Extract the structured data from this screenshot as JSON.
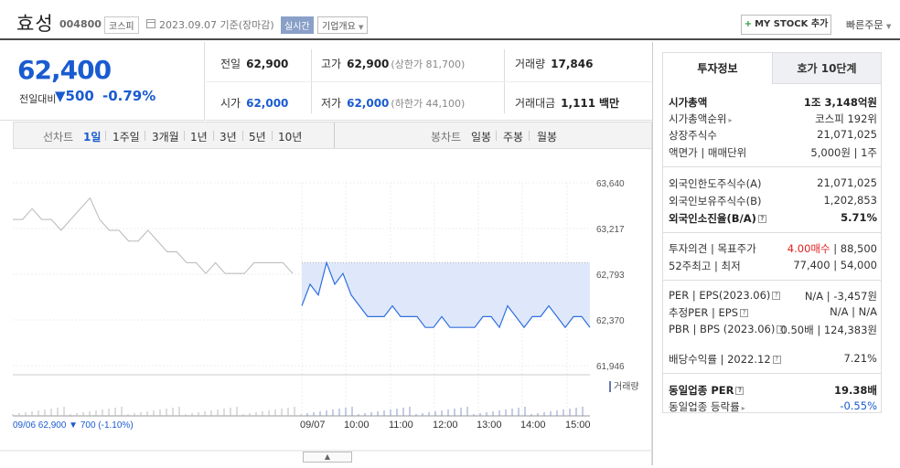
{
  "header": {
    "name": "효성",
    "code": "004800",
    "market_badge": "코스피",
    "date_text": "2023.09.07 기준(장마감)",
    "realtime_label": "실시간",
    "company_overview": "기업개요",
    "mystock_label": "MY STOCK 추가",
    "quick_order": "빠른주문"
  },
  "price": {
    "current": "62,400",
    "prev_label": "전일대비",
    "change": "500",
    "change_pct": "-0.79%"
  },
  "quote": {
    "prev_close_label": "전일",
    "prev_close": "62,900",
    "high_label": "고가",
    "high": "62,900",
    "high_sub": "(상한가 81,700)",
    "volume_label": "거래량",
    "volume": "17,846",
    "open_label": "시가",
    "open": "62,000",
    "low_label": "저가",
    "low": "62,000",
    "low_sub": "(하한가 44,100)",
    "amount_label": "거래대금",
    "amount": "1,111",
    "amount_unit": "백만"
  },
  "period_bar": {
    "line_label": "선차트",
    "line_items": [
      "1일",
      "1주일",
      "3개월",
      "1년",
      "3년",
      "5년",
      "10년"
    ],
    "active_index": 0,
    "candle_label": "봉차트",
    "candle_items": [
      "일봉",
      "주봉",
      "월봉"
    ]
  },
  "chart_data": {
    "type": "line",
    "y_ticks": [
      "63,640",
      "63,217",
      "62,793",
      "62,370",
      "61,946"
    ],
    "ylim": [
      61946,
      63640
    ],
    "x_ticks": [
      "09/07",
      "10:00",
      "11:00",
      "12:00",
      "13:00",
      "14:00",
      "15:00"
    ],
    "reference_line": 62900,
    "volume_label": "거래량",
    "prev_day_summary": "09/06  62,900 ▼ 700 (-1.10%)",
    "series": [
      {
        "values": [
          62500,
          62700,
          62600,
          62900,
          62700,
          62800,
          62600,
          62500,
          62400,
          62400,
          62400,
          62500,
          62400,
          62400,
          62400,
          62300,
          62300,
          62400,
          62300,
          62300,
          62300,
          62300,
          62400,
          62400,
          62300,
          62500,
          62400,
          62300,
          62400,
          62400,
          62500,
          62400,
          62300,
          62400,
          62400,
          62300
        ]
      }
    ],
    "prev_series_values": [
      63300,
      63300,
      63400,
      63300,
      63300,
      63200,
      63300,
      63400,
      63500,
      63300,
      63200,
      63200,
      63100,
      63100,
      63200,
      63100,
      63000,
      63000,
      62900,
      62900,
      62800,
      62900,
      62800,
      62800,
      62800,
      62900,
      62900,
      62900,
      62900,
      62800
    ]
  },
  "side": {
    "tab_info": "투자정보",
    "tab_quotes": "호가 10단계",
    "rows1": [
      {
        "k": "시가총액",
        "v": "1조 3,148억원"
      },
      {
        "k": "시가총액순위",
        "v": "코스피 192위"
      },
      {
        "k": "상장주식수",
        "v": "21,071,025"
      },
      {
        "k": "액면가 | 매매단위",
        "v": "5,000원 | 1주"
      }
    ],
    "rows2": [
      {
        "k": "외국인한도주식수(A)",
        "v": "21,071,025"
      },
      {
        "k": "외국인보유주식수(B)",
        "v": "1,202,853"
      },
      {
        "k": "외국인소진율(B/A)",
        "v": "5.71%"
      }
    ],
    "rows3": [
      {
        "k": "투자의견 | 목표주가",
        "v_red": "4.00매수",
        "v": "88,500"
      },
      {
        "k": "52주최고 | 최저",
        "v": "77,400 | 54,000"
      }
    ],
    "rows4": [
      {
        "k": "PER | EPS(2023.06)",
        "v": "N/A | -3,457원"
      },
      {
        "k": "추정PER | EPS",
        "v": "N/A | N/A"
      },
      {
        "k": "PBR | BPS (2023.06)",
        "v": "0.50배 | 124,383원"
      },
      {
        "k": "배당수익률 | 2022.12",
        "v": "7.21%"
      }
    ],
    "rows5": [
      {
        "k": "동일업종 PER",
        "v": "19.38배"
      },
      {
        "k": "동일업종 등락률",
        "v": "-0.55%"
      }
    ]
  }
}
